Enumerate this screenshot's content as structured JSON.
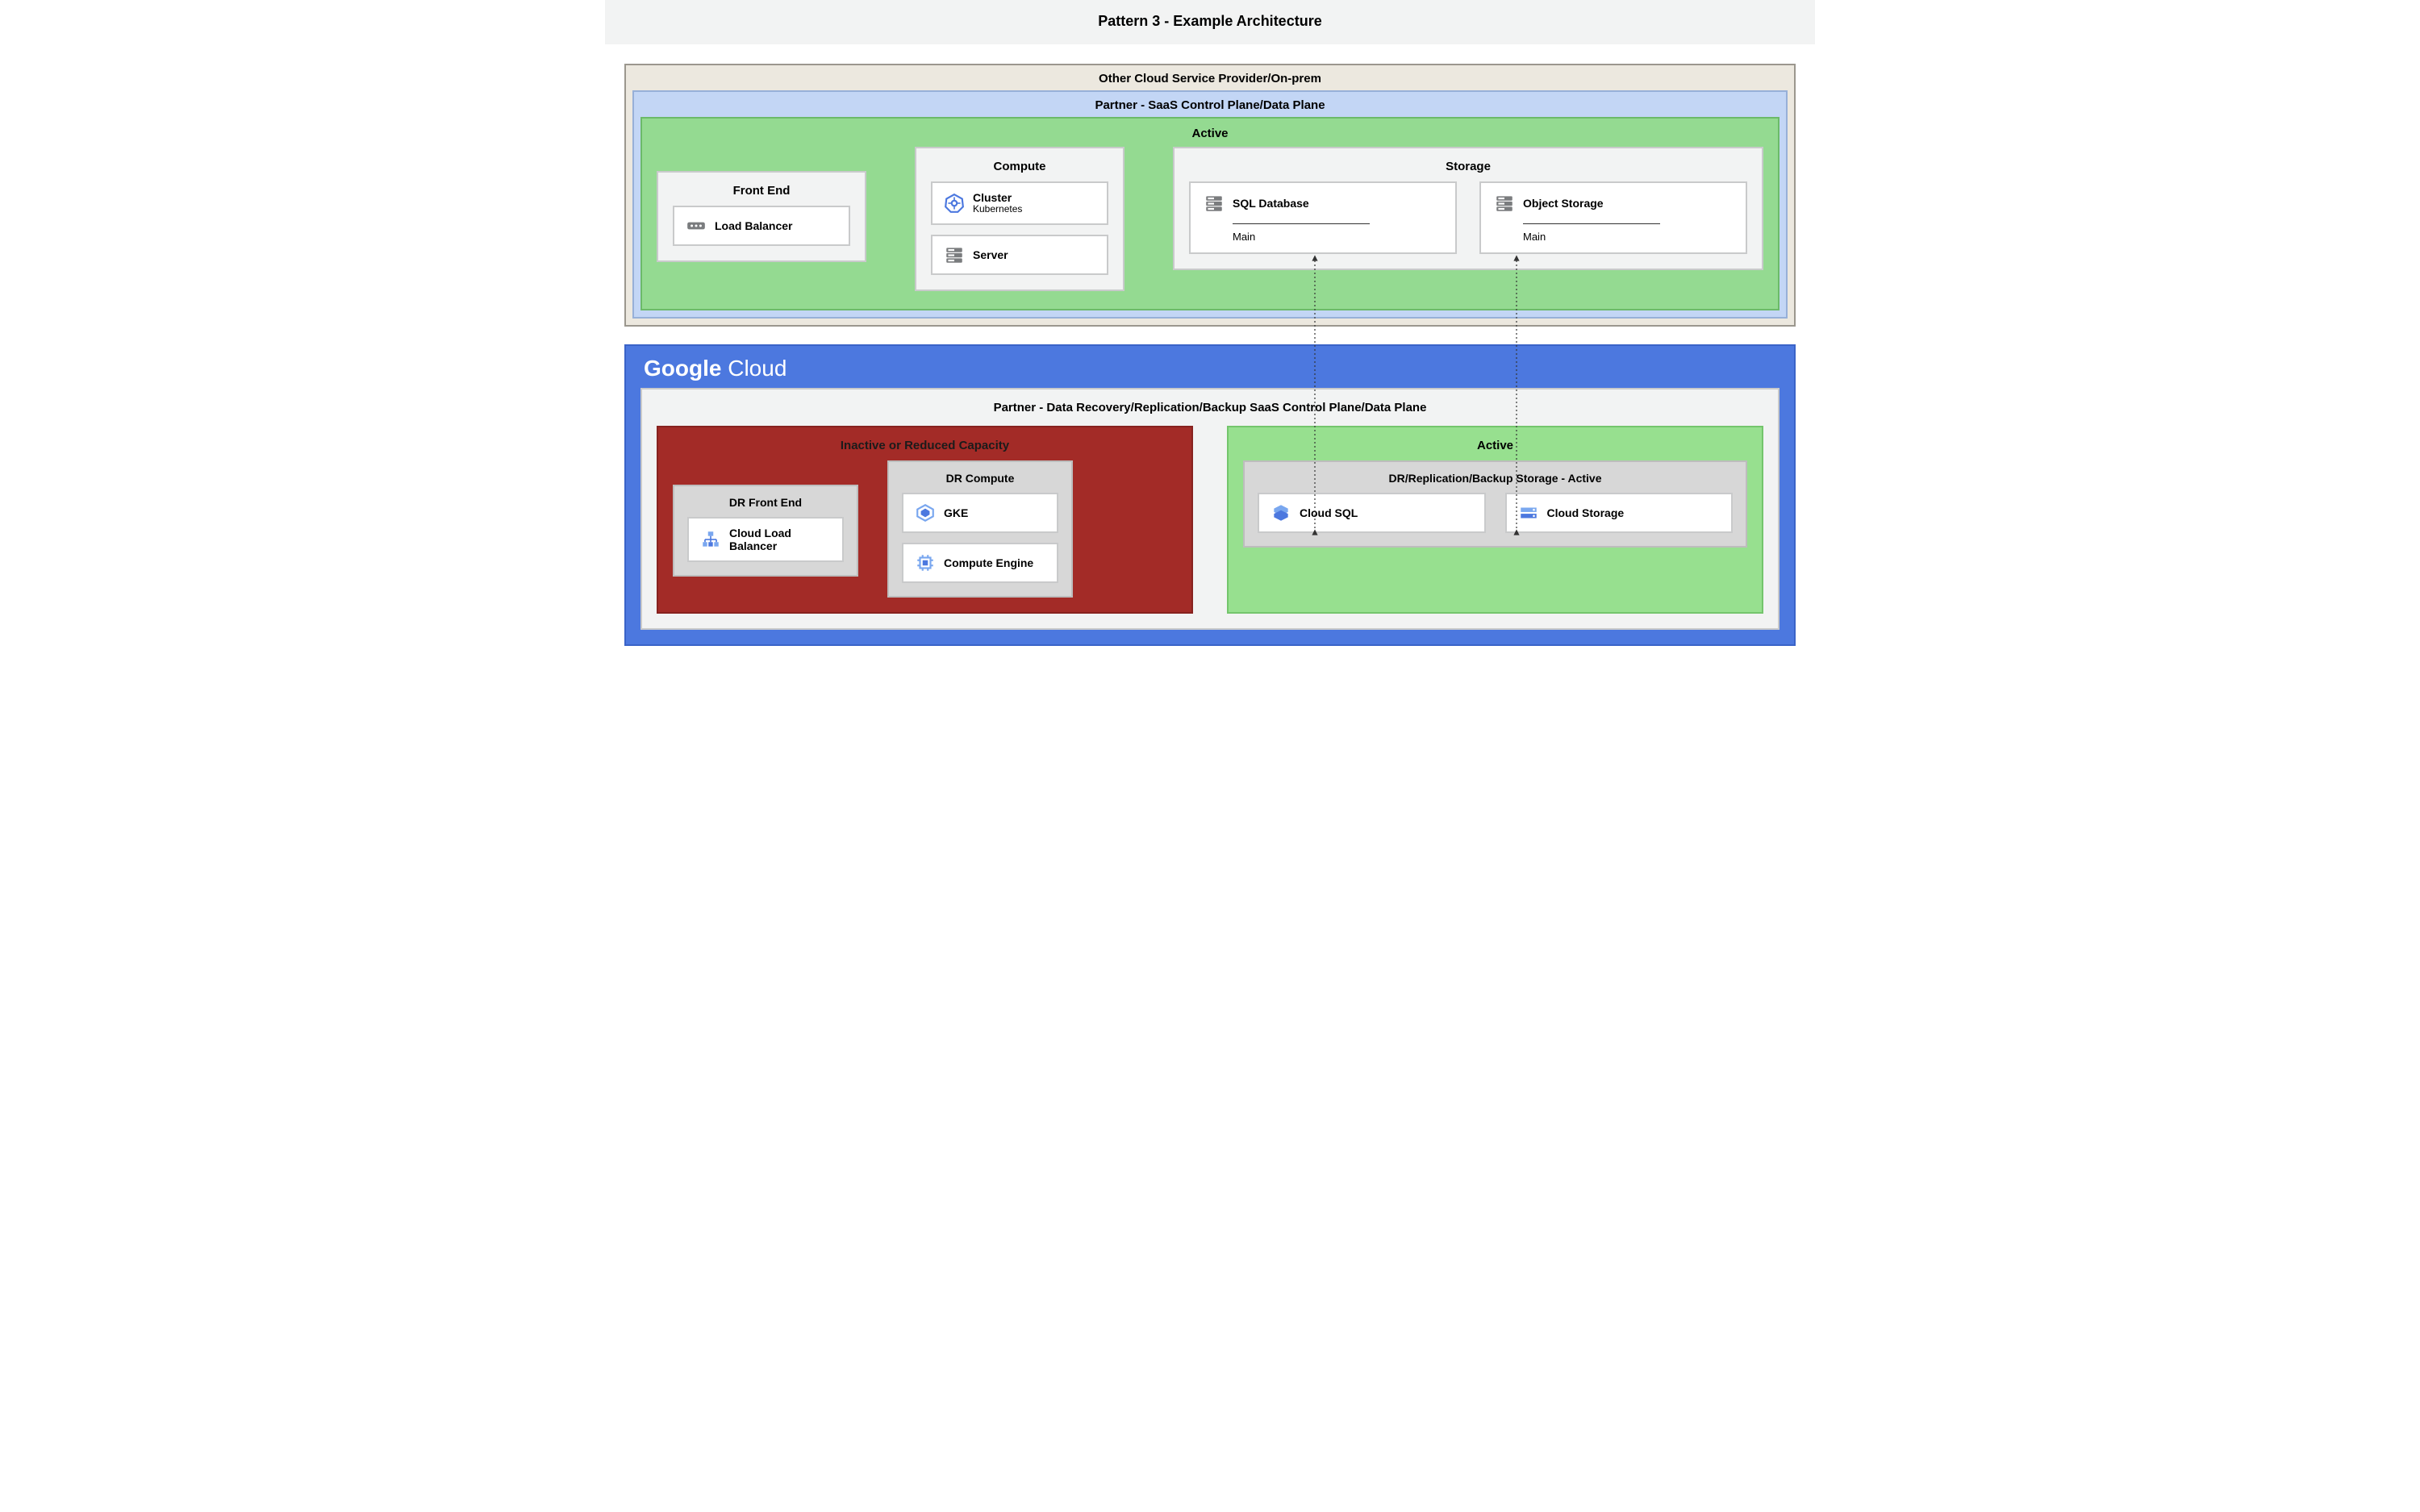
{
  "header": "Pattern 3 - Example Architecture",
  "csp": {
    "title": "Other Cloud Service Provider/On-prem"
  },
  "saas": {
    "title": "Partner - SaaS Control Plane/Data Plane"
  },
  "active_top": {
    "title": "Active",
    "front_end": {
      "title": "Front End",
      "load_balancer": "Load Balancer"
    },
    "compute": {
      "title": "Compute",
      "cluster_title": "Cluster",
      "cluster_sub": "Kubernetes",
      "server": "Server"
    },
    "storage": {
      "title": "Storage",
      "sql": {
        "title": "SQL Database",
        "sub": "Main"
      },
      "obj": {
        "title": "Object Storage",
        "sub": "Main"
      }
    }
  },
  "gcloud": {
    "logo_bold": "Google",
    "logo_light": " Cloud",
    "partner_title": "Partner - Data Recovery/Replication/Backup SaaS Control Plane/Data Plane",
    "inactive": {
      "title": "Inactive or Reduced Capacity",
      "dr_frontend": {
        "title": "DR Front End",
        "clb": "Cloud Load Balancer"
      },
      "dr_compute": {
        "title": "DR Compute",
        "gke": "GKE",
        "gce": "Compute Engine"
      }
    },
    "active": {
      "title": "Active",
      "dr_storage": {
        "title": "DR/Replication/Backup Storage - Active",
        "cloud_sql": "Cloud SQL",
        "cloud_storage": "Cloud Storage"
      }
    }
  }
}
